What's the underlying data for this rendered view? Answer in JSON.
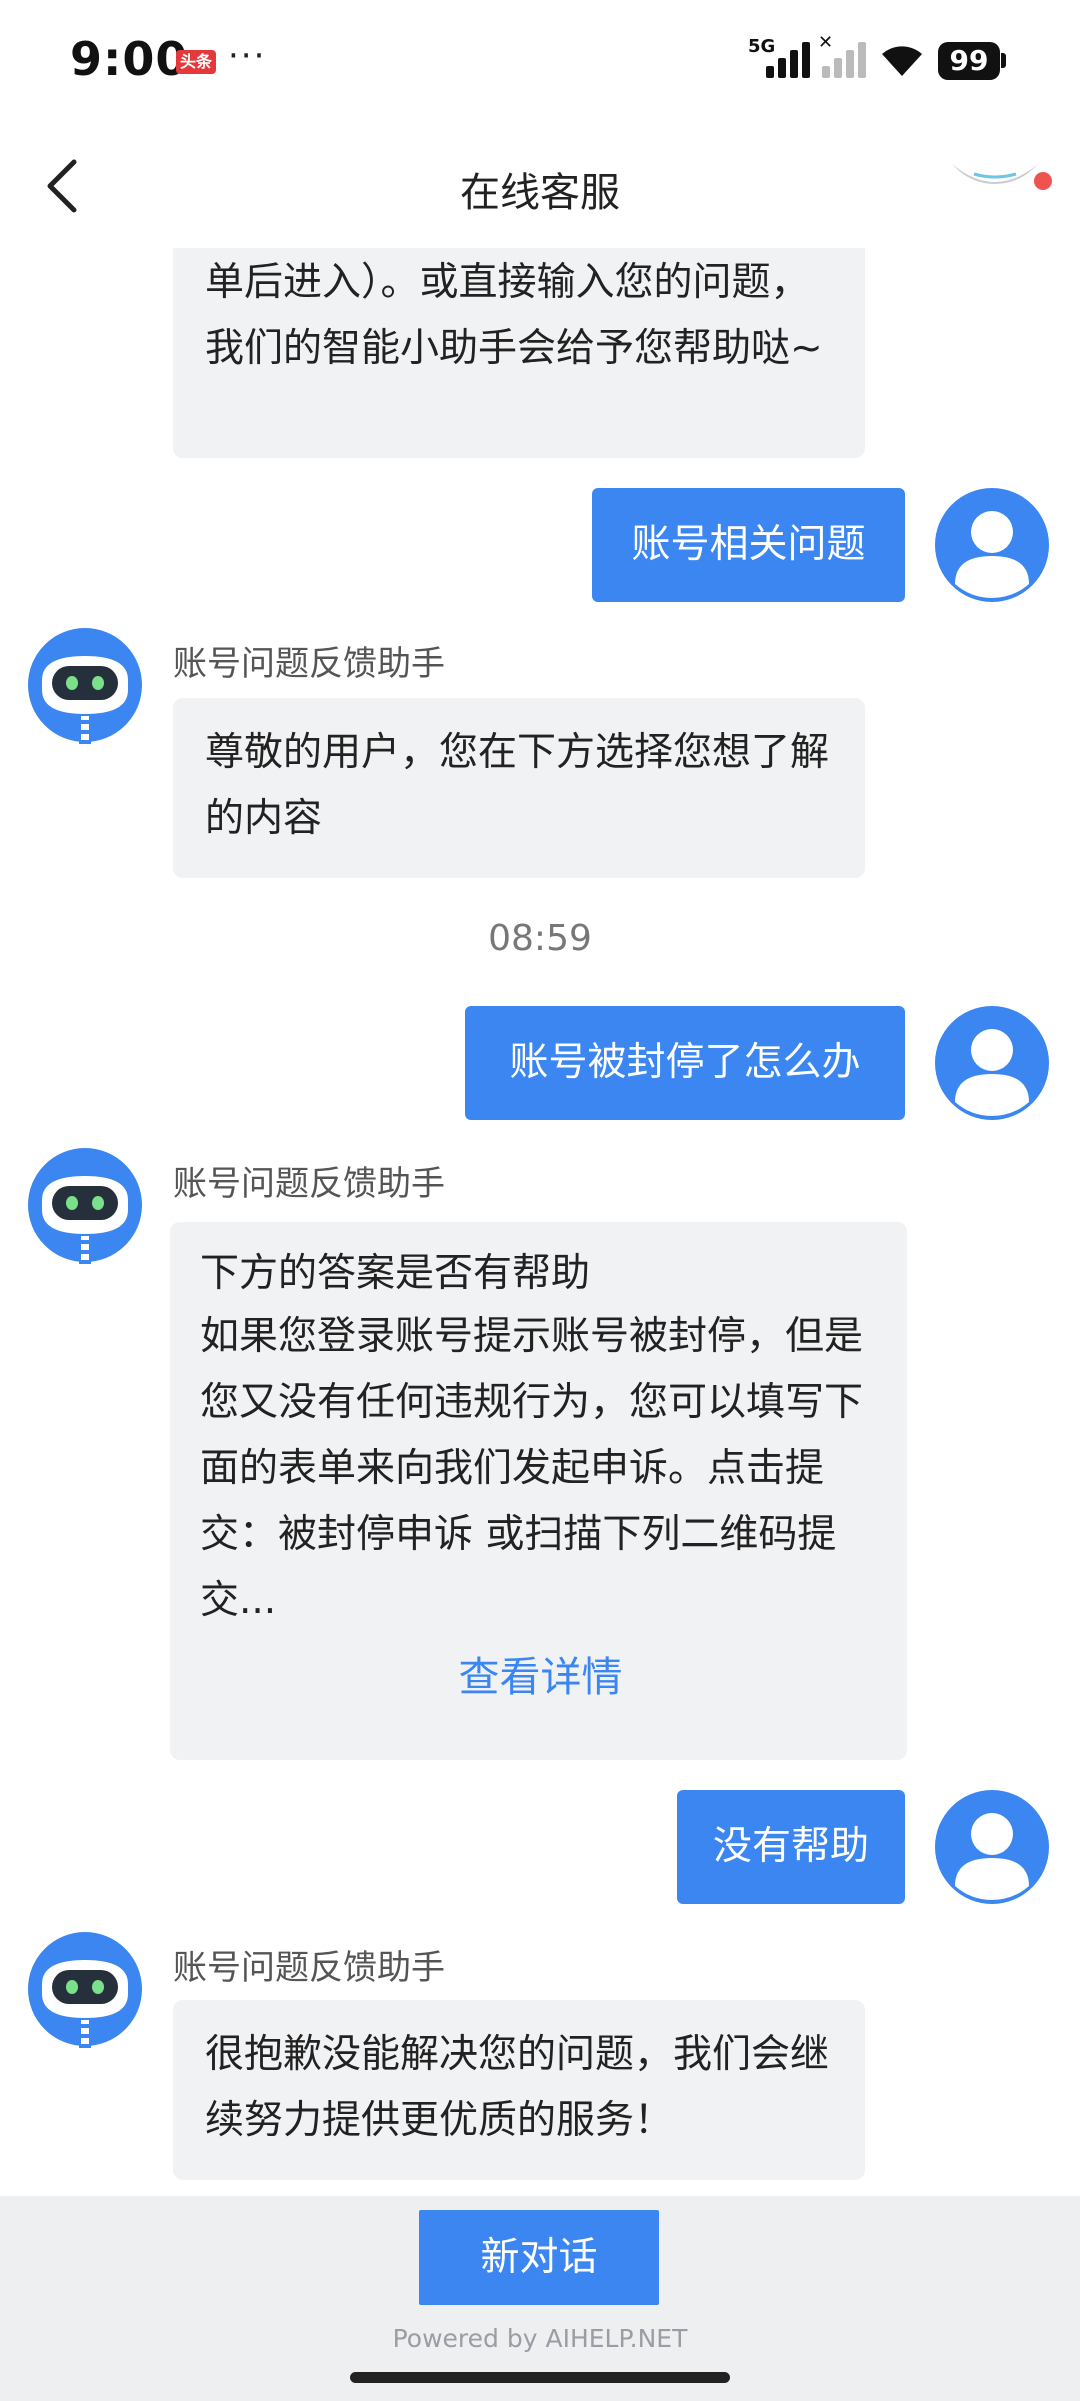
{
  "status_bar": {
    "time": "9:00",
    "app_badge": "头条",
    "more": "···",
    "network": "5G",
    "battery": "99"
  },
  "header": {
    "title": "在线客服"
  },
  "chat": {
    "bot_name": "账号问题反馈助手",
    "messages": [
      {
        "from": "bot",
        "text": "单后进入）。或直接输入您的问题，我们的智能小助手会给予您帮助哒~"
      },
      {
        "from": "user",
        "text": "账号相关问题"
      },
      {
        "from": "bot",
        "text": "尊敬的用户，您在下方选择您想了解的内容"
      },
      {
        "timestamp": "08:59"
      },
      {
        "from": "user",
        "text": "账号被封停了怎么办"
      },
      {
        "from": "bot",
        "title": "下方的答案是否有帮助",
        "text": "如果您登录账号提示账号被封停，但是您又没有任何违规行为，您可以填写下面的表单来向我们发起申诉。点击提交：被封停申诉 或扫描下列二维码提交...",
        "link": "查看详情"
      },
      {
        "from": "user",
        "text": "没有帮助"
      },
      {
        "from": "bot",
        "text": "很抱歉没能解决您的问题，我们会继续努力提供更优质的服务！"
      }
    ]
  },
  "footer": {
    "new_chat_label": "新对话",
    "powered_by": "Powered by AIHELP.NET"
  },
  "colors": {
    "accent": "#3b86f1",
    "bubble_in": "#f1f2f4",
    "footer_bg": "#eeeff1"
  }
}
